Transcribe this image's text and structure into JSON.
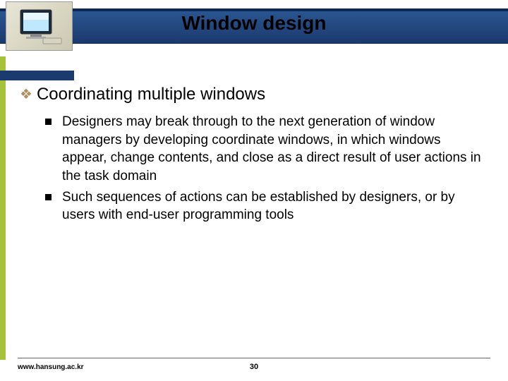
{
  "header": {
    "title": "Window design"
  },
  "section": {
    "heading": "Coordinating multiple windows",
    "bullets": [
      "Designers may break through to the next generation of window managers by developing coordinate windows, in which windows appear, change contents, and close as a direct result of user actions in the task domain",
      "Such sequences of actions can be established by designers, or by users with end-user programming tools"
    ]
  },
  "footer": {
    "url": "www.hansung.ac.kr",
    "page": "30"
  }
}
